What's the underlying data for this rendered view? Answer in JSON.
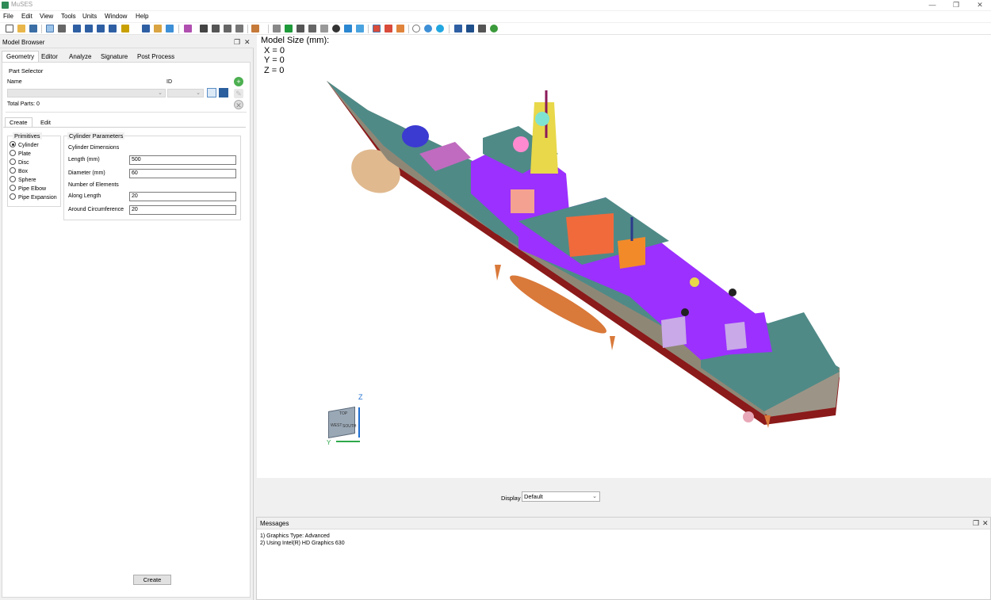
{
  "window": {
    "title": "MuSES"
  },
  "menu": [
    "File",
    "Edit",
    "View",
    "Tools",
    "Units",
    "Window",
    "Help"
  ],
  "model_browser": {
    "title": "Model Browser",
    "tabs": [
      "Geometry",
      "Editor",
      "Analyze",
      "Signature",
      "Post Process"
    ],
    "active_tab": "Geometry",
    "part_selector": {
      "label": "Part Selector",
      "name_label": "Name",
      "id_label": "ID",
      "total_parts": "Total Parts: 0"
    },
    "subtabs": [
      "Create",
      "Edit"
    ],
    "primitives": {
      "label": "Primitives",
      "options": [
        "Cylinder",
        "Plate",
        "Disc",
        "Box",
        "Sphere",
        "Pipe Elbow",
        "Pipe Expansion"
      ],
      "selected": "Cylinder"
    },
    "cylinder_params": {
      "label": "Cylinder Parameters",
      "dimensions_label": "Cylinder Dimensions",
      "length_label": "Length (mm)",
      "length_value": "500",
      "diameter_label": "Diameter (mm)",
      "diameter_value": "60",
      "elements_label": "Number of Elements",
      "along_length_label": "Along Length",
      "along_length_value": "20",
      "around_circ_label": "Around Circumference",
      "around_circ_value": "20"
    },
    "create_button": "Create"
  },
  "viewport": {
    "model_size_title": "Model Size (mm):",
    "x_line": "X = 0",
    "y_line": "Y = 0",
    "z_line": "Z = 0",
    "axis_z": "Z",
    "axis_y": "Y",
    "cube_faces": [
      "TOP",
      "WEST",
      "SOUTH"
    ]
  },
  "display": {
    "label": "Display",
    "value": "Default"
  },
  "messages": {
    "title": "Messages",
    "lines": [
      "1) Graphics Type: Advanced",
      "2) Using Intel(R) HD Graphics 630"
    ]
  },
  "colors": {
    "hull_teal": "#4f8a87",
    "superstructure_purple": "#9b30ff",
    "hull_grey": "#8f8776",
    "keel_red": "#8b1a1a",
    "sonar_dome": "#e0b98f",
    "accent_orange": "#f06a3c",
    "yellow_mast": "#e8d84a"
  }
}
